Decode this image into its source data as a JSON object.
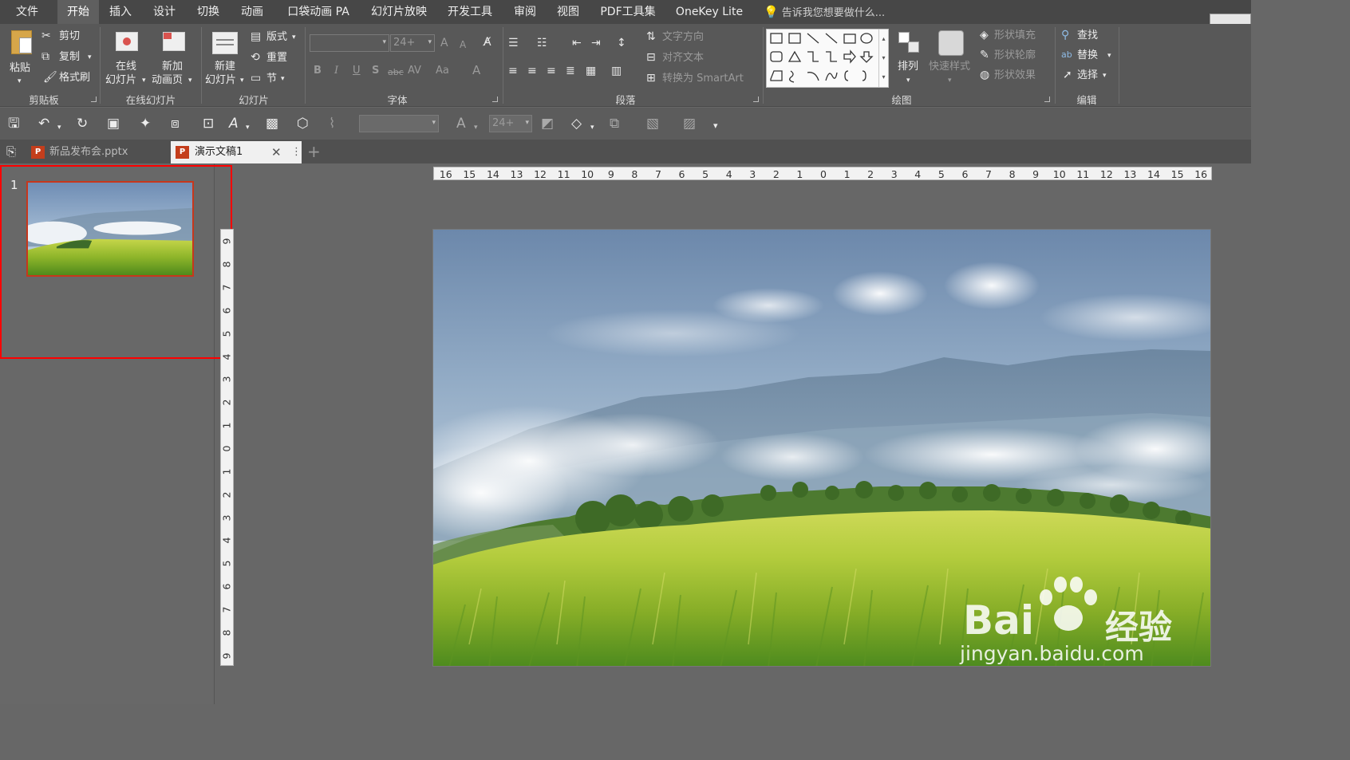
{
  "menu": {
    "tabs": [
      {
        "label": "文件"
      },
      {
        "label": "开始"
      },
      {
        "label": "插入"
      },
      {
        "label": "设计"
      },
      {
        "label": "切换"
      },
      {
        "label": "动画"
      },
      {
        "label": "口袋动画 PA"
      },
      {
        "label": "幻灯片放映"
      },
      {
        "label": "开发工具"
      },
      {
        "label": "审阅"
      },
      {
        "label": "视图"
      },
      {
        "label": "PDF工具集"
      },
      {
        "label": "OneKey Lite"
      }
    ],
    "active": "开始",
    "tell_me": "告诉我您想要做什么..."
  },
  "ribbon": {
    "clipboard": {
      "paste": "粘贴",
      "cut": "剪切",
      "copy": "复制",
      "format_painter": "格式刷",
      "label": "剪贴板"
    },
    "online": {
      "online_slide_1": "在线",
      "online_slide_2": "幻灯片",
      "new_anim_1": "新加",
      "new_anim_2": "动画页",
      "label": "在线幻灯片"
    },
    "slides": {
      "new_slide_1": "新建",
      "new_slide_2": "幻灯片",
      "layout": "版式",
      "reset": "重置",
      "section": "节",
      "label": "幻灯片"
    },
    "font": {
      "size": "24+",
      "bold": "B",
      "italic": "I",
      "underline": "U",
      "shadow": "S",
      "strike": "abc",
      "spacing": "AV",
      "case": "Aa",
      "color": "A",
      "grow": "A",
      "shrink": "A",
      "label": "字体"
    },
    "paragraph": {
      "text_direction": "文字方向",
      "align_text": "对齐文本",
      "smartart": "转换为 SmartArt",
      "label": "段落"
    },
    "drawing": {
      "arrange": "排列",
      "quick_styles": "快速样式",
      "fill": "形状填充",
      "outline": "形状轮廓",
      "effects": "形状效果",
      "label": "绘图"
    },
    "editing": {
      "find": "查找",
      "replace": "替换",
      "select": "选择",
      "label": "编辑"
    }
  },
  "qat": {
    "font_size": "24+"
  },
  "doc_tabs": [
    {
      "label": "新品发布会.pptx",
      "active": false
    },
    {
      "label": "演示文稿1",
      "active": true
    }
  ],
  "thumbnails": [
    {
      "number": "1"
    }
  ],
  "rulers": {
    "horizontal": [
      "16",
      "15",
      "14",
      "13",
      "12",
      "11",
      "10",
      "9",
      "8",
      "7",
      "6",
      "5",
      "4",
      "3",
      "2",
      "1",
      "0",
      "1",
      "2",
      "3",
      "4",
      "5",
      "6",
      "7",
      "8",
      "9",
      "10",
      "11",
      "12",
      "13",
      "14",
      "15",
      "16"
    ],
    "vertical": [
      "9",
      "8",
      "7",
      "6",
      "5",
      "4",
      "3",
      "2",
      "1",
      "0",
      "1",
      "2",
      "3",
      "4",
      "5",
      "6",
      "7",
      "8",
      "9"
    ]
  },
  "watermark": {
    "brand": "Bai",
    "brand_cn": "经验",
    "url": "jingyan.baidu.com"
  },
  "colors": {
    "menu_bg": "#474747",
    "ribbon_bg": "#585858",
    "accent_red": "#ff0000",
    "ppt_orange": "#c43e1c"
  }
}
